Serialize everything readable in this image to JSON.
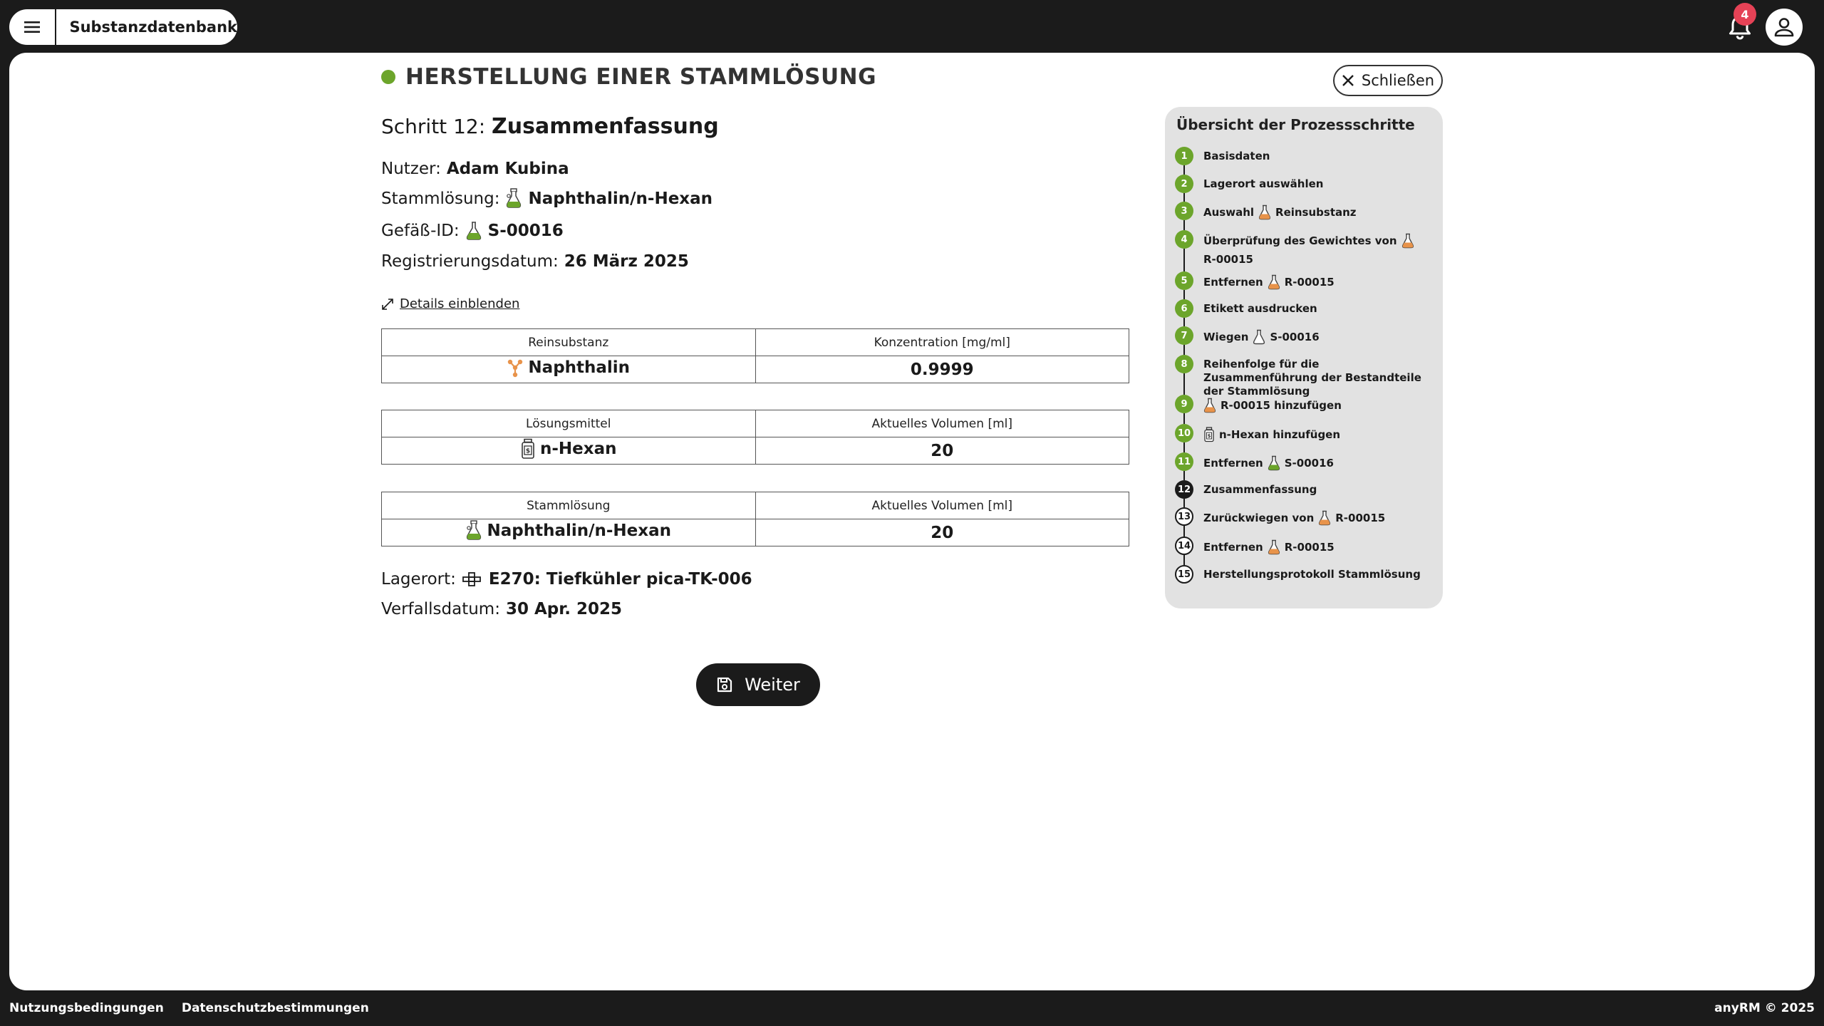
{
  "topbar": {
    "app_name": "Substanzdatenbank",
    "notification_count": "4"
  },
  "page": {
    "title": "HERSTELLUNG EINER STAMMLÖSUNG",
    "close_label": "Schließen",
    "step_prefix": "Schritt 12:",
    "step_name": "Zusammenfassung"
  },
  "info": {
    "user_label": "Nutzer:",
    "user_value": "Adam Kubina",
    "stock_label": "Stammlösung:",
    "stock_value": "Naphthalin/n-Hexan",
    "vessel_label": "Gefäß-ID:",
    "vessel_value": "S-00016",
    "reg_label": "Registrierungsdatum:",
    "reg_value": "26 März 2025",
    "details_link": "Details einblenden",
    "location_label": "Lagerort:",
    "location_value": "E270: Tiefkühler pica-TK-006",
    "expiry_label": "Verfallsdatum:",
    "expiry_value": "30 Apr. 2025"
  },
  "tables": [
    {
      "h1": "Reinsubstanz",
      "h2": "Konzentration [mg/ml]",
      "v1": "Naphthalin",
      "v2": "0.9999",
      "icon": "molecule-icon"
    },
    {
      "h1": "Lösungsmittel",
      "h2": "Aktuelles Volumen [ml]",
      "v1": "n-Hexan",
      "v2": "20",
      "icon": "solvent-bottle-icon"
    },
    {
      "h1": "Stammlösung",
      "h2": "Aktuelles Volumen [ml]",
      "v1": "Naphthalin/n-Hexan",
      "v2": "20",
      "icon": "stock-solution-icon"
    }
  ],
  "weiter_label": "Weiter",
  "side": {
    "title": "Übersicht der Prozessschritte",
    "steps": [
      {
        "n": "1",
        "a": "Basisdaten",
        "state": "done"
      },
      {
        "n": "2",
        "a": "Lagerort auswählen",
        "state": "done"
      },
      {
        "n": "3",
        "a": "Auswahl",
        "icon": "flask-orange",
        "b": "Reinsubstanz",
        "state": "done"
      },
      {
        "n": "4",
        "a": "Überprüfung des Gewichtes von",
        "icon": "flask-orange",
        "b": "R-00015",
        "state": "done"
      },
      {
        "n": "5",
        "a": "Entfernen",
        "icon": "flask-orange",
        "b": "R-00015",
        "state": "done"
      },
      {
        "n": "6",
        "a": "Etikett ausdrucken",
        "state": "done"
      },
      {
        "n": "7",
        "a": "Wiegen",
        "icon": "flask-empty",
        "b": "S-00016",
        "state": "done"
      },
      {
        "n": "8",
        "a": "Reihenfolge für die Zusammenführung der Bestandteile der Stammlösung",
        "state": "done"
      },
      {
        "n": "9",
        "a": "",
        "icon": "flask-orange",
        "b": "R-00015 hinzufügen",
        "state": "done"
      },
      {
        "n": "10",
        "a": "",
        "icon": "solvent-bottle",
        "b": "n-Hexan hinzufügen",
        "state": "done"
      },
      {
        "n": "11",
        "a": "Entfernen",
        "icon": "flask-green",
        "b": "S-00016",
        "state": "done"
      },
      {
        "n": "12",
        "a": "Zusammenfassung",
        "state": "current"
      },
      {
        "n": "13",
        "a": "Zurückwiegen von",
        "icon": "flask-orange",
        "b": "R-00015",
        "state": "todo"
      },
      {
        "n": "14",
        "a": "Entfernen",
        "icon": "flask-orange",
        "b": "R-00015",
        "state": "todo"
      },
      {
        "n": "15",
        "a": "Herstellungsprotokoll Stammlösung",
        "state": "todo"
      }
    ]
  },
  "footer": {
    "terms": "Nutzungsbedingungen",
    "privacy": "Datenschutzbestimmungen",
    "copyright": "anyRM © 2025"
  },
  "colors": {
    "accent_green": "#6ca52b",
    "flask_orange": "#e8934a",
    "badge_red": "#e54256",
    "dark": "#1b1b1b"
  }
}
